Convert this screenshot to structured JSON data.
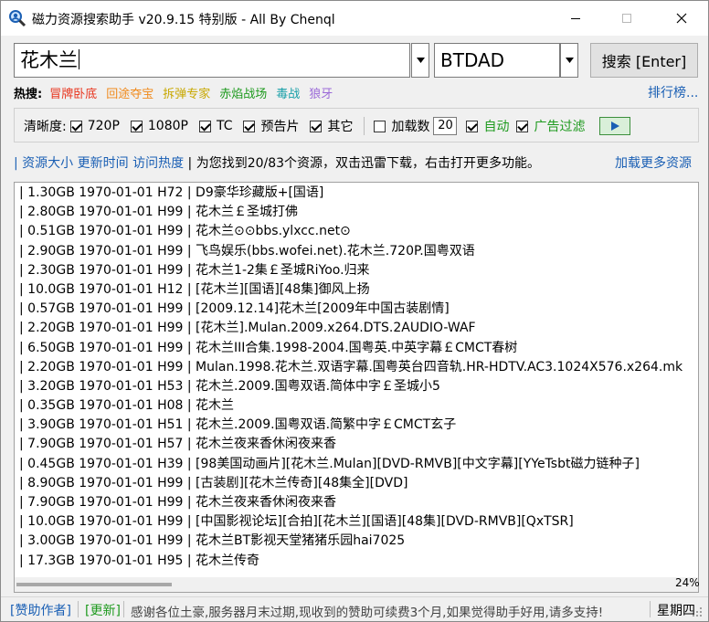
{
  "window": {
    "title": "磁力资源搜索助手 v20.9.15 特别版 - All By Chenql"
  },
  "search": {
    "query": "花木兰",
    "engine": "BTDAD",
    "button_label": "搜索 [Enter]"
  },
  "hot": {
    "label": "热搜:",
    "items": [
      {
        "text": "冒牌卧底",
        "color": "#e8331c"
      },
      {
        "text": "回途夺宝",
        "color": "#f08a1c"
      },
      {
        "text": "拆弹专家",
        "color": "#c8a800"
      },
      {
        "text": "赤焰战场",
        "color": "#1e9a1e"
      },
      {
        "text": "毒战",
        "color": "#19a0a8"
      },
      {
        "text": "狼牙",
        "color": "#9b6ad8"
      }
    ],
    "ranking_label": "排行榜..."
  },
  "filters": {
    "clarity_label": "清晰度:",
    "options": [
      {
        "label": "720P",
        "checked": true
      },
      {
        "label": "1080P",
        "checked": true
      },
      {
        "label": "TC",
        "checked": true
      },
      {
        "label": "预告片",
        "checked": true
      },
      {
        "label": "其它",
        "checked": true
      }
    ],
    "load_count_label": "加载数",
    "load_count_checked": false,
    "load_count_value": "20",
    "auto_label": "自动",
    "auto_checked": true,
    "ad_filter_label": "广告过滤",
    "ad_filter_checked": true
  },
  "info": {
    "sort_size": "资源大小",
    "sort_time": "更新时间",
    "sort_heat": "访问热度",
    "status": "为您找到20/83个资源，双击迅雷下载，右击打开更多功能。",
    "load_more": "加载更多资源"
  },
  "results": [
    {
      "size": "1.30GB",
      "date": "1970-01-01",
      "heat": "H72",
      "name": "D9豪华珍藏版+[国语]"
    },
    {
      "size": "2.80GB",
      "date": "1970-01-01",
      "heat": "H99",
      "name": "花木兰￡圣城打佛"
    },
    {
      "size": "0.51GB",
      "date": "1970-01-01",
      "heat": "H99",
      "name": "花木兰⊙⊙bbs.ylxcc.net⊙"
    },
    {
      "size": "2.90GB",
      "date": "1970-01-01",
      "heat": "H99",
      "name": "飞鸟娱乐(bbs.wofei.net).花木兰.720P.国粤双语"
    },
    {
      "size": "2.30GB",
      "date": "1970-01-01",
      "heat": "H99",
      "name": "花木兰1-2集￡圣城RiYoo.归来"
    },
    {
      "size": "10.0GB",
      "date": "1970-01-01",
      "heat": "H12",
      "name": "[花木兰][国语][48集]御风上扬"
    },
    {
      "size": "0.57GB",
      "date": "1970-01-01",
      "heat": "H99",
      "name": "[2009.12.14]花木兰[2009年中国古装剧情]"
    },
    {
      "size": "2.20GB",
      "date": "1970-01-01",
      "heat": "H99",
      "name": "[花木兰].Mulan.2009.x264.DTS.2AUDIO-WAF"
    },
    {
      "size": "6.50GB",
      "date": "1970-01-01",
      "heat": "H99",
      "name": "花木兰III合集.1998-2004.国粤英.中英字幕￡CMCT春树"
    },
    {
      "size": "2.20GB",
      "date": "1970-01-01",
      "heat": "H99",
      "name": "Mulan.1998.花木兰.双语字幕.国粤英台四音轨.HR-HDTV.AC3.1024X576.x264.mk"
    },
    {
      "size": "3.20GB",
      "date": "1970-01-01",
      "heat": "H53",
      "name": "花木兰.2009.国粤双语.简体中字￡圣城小5"
    },
    {
      "size": "0.35GB",
      "date": "1970-01-01",
      "heat": "H08",
      "name": "花木兰"
    },
    {
      "size": "3.90GB",
      "date": "1970-01-01",
      "heat": "H51",
      "name": "花木兰.2009.国粤双语.简繁中字￡CMCT玄子"
    },
    {
      "size": "7.90GB",
      "date": "1970-01-01",
      "heat": "H57",
      "name": "花木兰夜来香休闲夜来香"
    },
    {
      "size": "0.45GB",
      "date": "1970-01-01",
      "heat": "H39",
      "name": "[98美国动画片][花木兰.Mulan][DVD-RMVB][中文字幕][YYeTsbt磁力链种子]"
    },
    {
      "size": "8.90GB",
      "date": "1970-01-01",
      "heat": "H99",
      "name": "[古装剧][花木兰传奇][48集全][DVD]"
    },
    {
      "size": "7.90GB",
      "date": "1970-01-01",
      "heat": "H99",
      "name": "花木兰夜来香休闲夜来香"
    },
    {
      "size": "10.0GB",
      "date": "1970-01-01",
      "heat": "H99",
      "name": "[中国影视论坛][合拍][花木兰][国语][48集][DVD-RMVB][QxTSR]"
    },
    {
      "size": "3.00GB",
      "date": "1970-01-01",
      "heat": "H99",
      "name": "花木兰BT影视天堂猪猪乐园hai7025"
    },
    {
      "size": "17.3GB",
      "date": "1970-01-01",
      "heat": "H95",
      "name": "花木兰传奇"
    }
  ],
  "percent": "24%",
  "status": {
    "sponsor": "[赞助作者]",
    "update": "[更新]",
    "notice": "感谢各位土豪,服务器月末过期,现收到的赞助可续费3个月,如果觉得助手好用,请多支持!",
    "day": "星期四"
  }
}
